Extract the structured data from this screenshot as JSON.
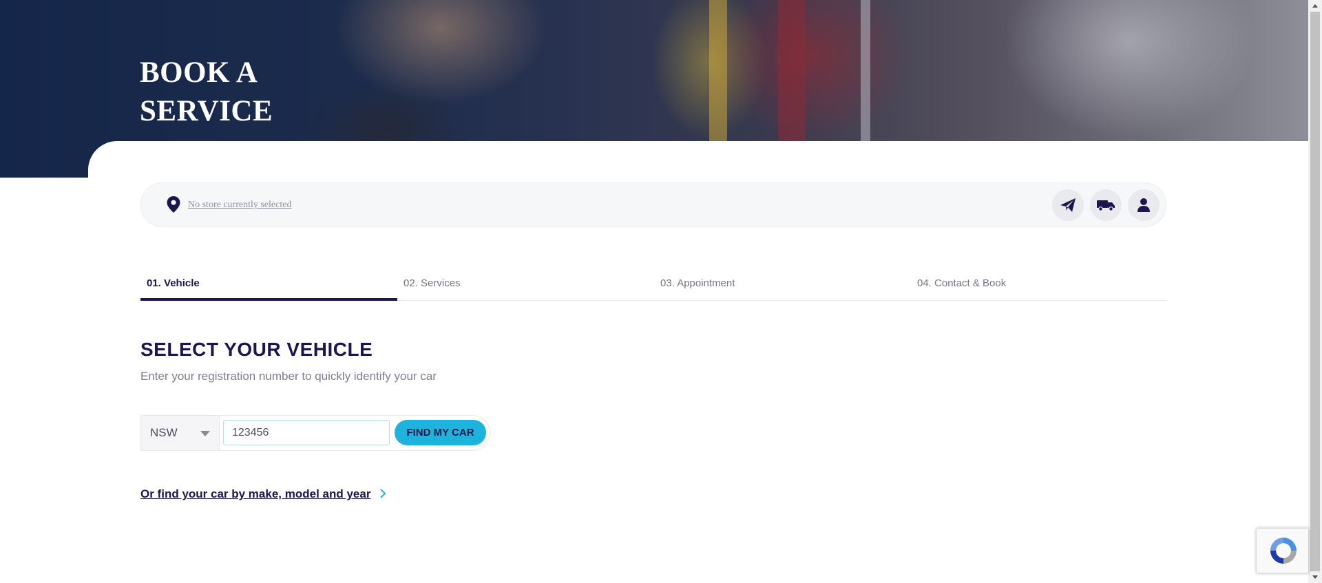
{
  "hero": {
    "title": "BOOK A SERVICE"
  },
  "store": {
    "link_text": "No store currently selected",
    "icons": [
      "location-pin-icon",
      "send-icon",
      "truck-icon",
      "user-icon"
    ]
  },
  "steps": [
    {
      "label": "01. Vehicle",
      "active": true
    },
    {
      "label": "02. Services",
      "active": false
    },
    {
      "label": "03. Appointment",
      "active": false
    },
    {
      "label": "04. Contact & Book",
      "active": false
    }
  ],
  "vehicle": {
    "heading": "SELECT YOUR VEHICLE",
    "subheading": "Enter your registration number to quickly identify your car",
    "state": "NSW",
    "rego_value": "123456",
    "find_button": "FIND MY CAR",
    "make_model_link": "Or find your car by make, model and year"
  },
  "colors": {
    "brand_navy": "#1c1650",
    "accent_cyan": "#1eb3dc",
    "muted_text": "#7d7d92"
  }
}
